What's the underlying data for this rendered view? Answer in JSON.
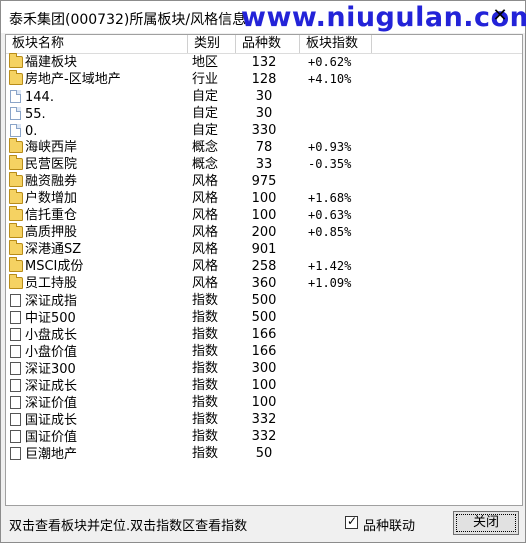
{
  "window": {
    "title": "泰禾集团(000732)所属板块/风格信息",
    "watermark": "www.niugulan.com",
    "close_glyph": "✕"
  },
  "table": {
    "headers": [
      "板块名称",
      "类别",
      "品种数",
      "板块指数"
    ],
    "rows": [
      {
        "icon": "folder",
        "name": "福建板块",
        "category": "地区",
        "count": "132",
        "index": "+0.62%"
      },
      {
        "icon": "folder",
        "name": "房地产-区域地产",
        "category": "行业",
        "count": "128",
        "index": "+4.10%"
      },
      {
        "icon": "page",
        "name": "144.",
        "category": "自定",
        "count": "30",
        "index": ""
      },
      {
        "icon": "page",
        "name": "55.",
        "category": "自定",
        "count": "30",
        "index": ""
      },
      {
        "icon": "page",
        "name": "0.",
        "category": "自定",
        "count": "330",
        "index": ""
      },
      {
        "icon": "folder",
        "name": "海峡西岸",
        "category": "概念",
        "count": "78",
        "index": "+0.93%"
      },
      {
        "icon": "folder",
        "name": "民营医院",
        "category": "概念",
        "count": "33",
        "index": "-0.35%"
      },
      {
        "icon": "folder",
        "name": "融资融券",
        "category": "风格",
        "count": "975",
        "index": ""
      },
      {
        "icon": "folder",
        "name": "户数增加",
        "category": "风格",
        "count": "100",
        "index": "+1.68%"
      },
      {
        "icon": "folder",
        "name": "信托重仓",
        "category": "风格",
        "count": "100",
        "index": "+0.63%"
      },
      {
        "icon": "folder",
        "name": "高质押股",
        "category": "风格",
        "count": "200",
        "index": "+0.85%"
      },
      {
        "icon": "folder",
        "name": "深港通SZ",
        "category": "风格",
        "count": "901",
        "index": ""
      },
      {
        "icon": "folder",
        "name": "MSCI成份",
        "category": "风格",
        "count": "258",
        "index": "+1.42%"
      },
      {
        "icon": "folder",
        "name": "员工持股",
        "category": "风格",
        "count": "360",
        "index": "+1.09%"
      },
      {
        "icon": "doc",
        "name": "深证成指",
        "category": "指数",
        "count": "500",
        "index": ""
      },
      {
        "icon": "doc",
        "name": "中证500",
        "category": "指数",
        "count": "500",
        "index": ""
      },
      {
        "icon": "doc",
        "name": "小盘成长",
        "category": "指数",
        "count": "166",
        "index": ""
      },
      {
        "icon": "doc",
        "name": "小盘价值",
        "category": "指数",
        "count": "166",
        "index": ""
      },
      {
        "icon": "doc",
        "name": "深证300",
        "category": "指数",
        "count": "300",
        "index": ""
      },
      {
        "icon": "doc",
        "name": "深证成长",
        "category": "指数",
        "count": "100",
        "index": ""
      },
      {
        "icon": "doc",
        "name": "深证价值",
        "category": "指数",
        "count": "100",
        "index": ""
      },
      {
        "icon": "doc",
        "name": "国证成长",
        "category": "指数",
        "count": "332",
        "index": ""
      },
      {
        "icon": "doc",
        "name": "国证价值",
        "category": "指数",
        "count": "332",
        "index": ""
      },
      {
        "icon": "doc",
        "name": "巨潮地产",
        "category": "指数",
        "count": "50",
        "index": ""
      }
    ]
  },
  "footer": {
    "hint": "双击查看板块并定位.双击指数区查看指数",
    "checkbox_label": "品种联动",
    "checkbox_checked": true,
    "close_label": "关闭"
  },
  "colors": {
    "watermark": "#2323d8",
    "folder": "#f5d262"
  }
}
